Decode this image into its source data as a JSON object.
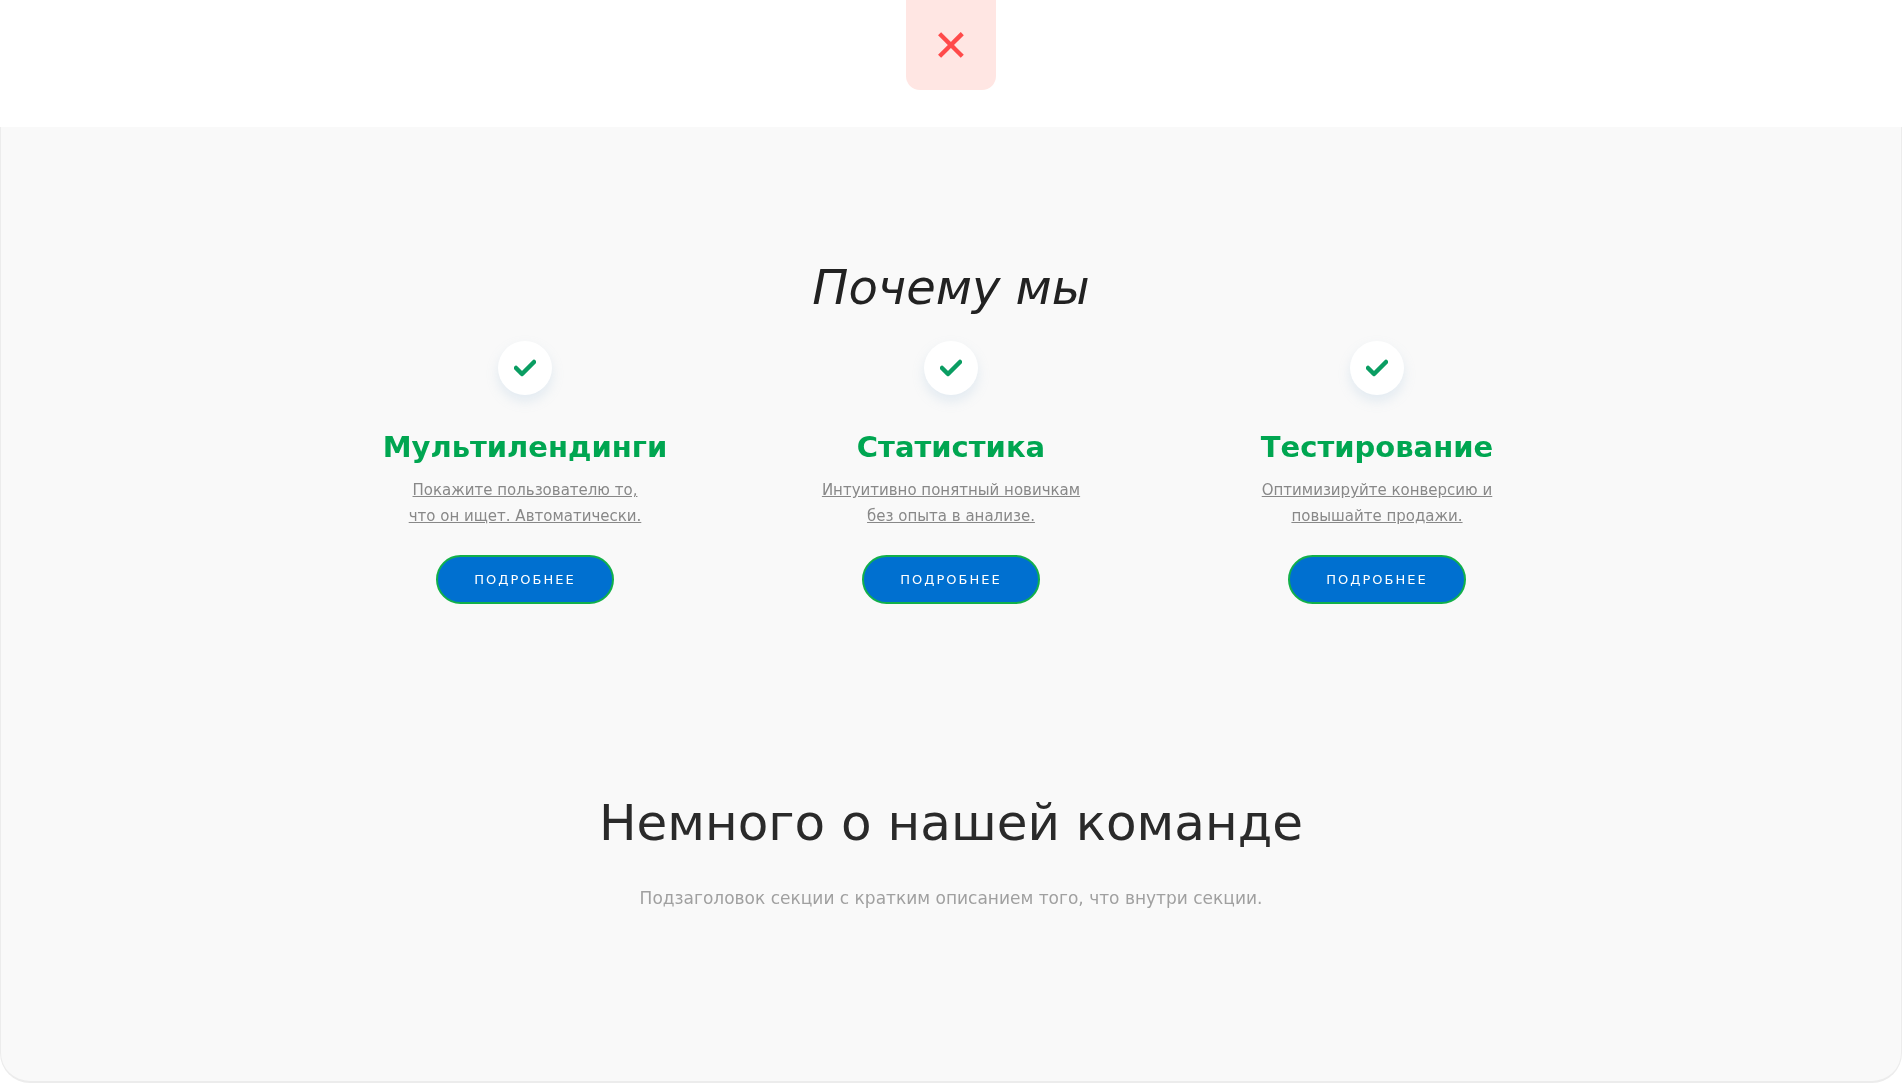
{
  "close_button": {
    "label": "✕"
  },
  "why_us": {
    "title": "Почему мы",
    "features": [
      {
        "title": "Мультилендинги",
        "description": "Покажите пользователю то,\nчто он ищет. Автоматически.",
        "button": "ПОДРОБНЕЕ"
      },
      {
        "title": "Статистика",
        "description": "Интуитивно понятный новичкам\nбез опыта в анализе.",
        "button": "ПОДРОБНЕЕ"
      },
      {
        "title": "Тестирование",
        "description": "Оптимизируйте конверсию и\nповышайте продажи.",
        "button": "ПОДРОБНЕЕ"
      }
    ]
  },
  "team": {
    "title": "Немного о нашей команде",
    "subtitle": "Подзаголовок секции с кратким описанием того, что внутри секции."
  }
}
